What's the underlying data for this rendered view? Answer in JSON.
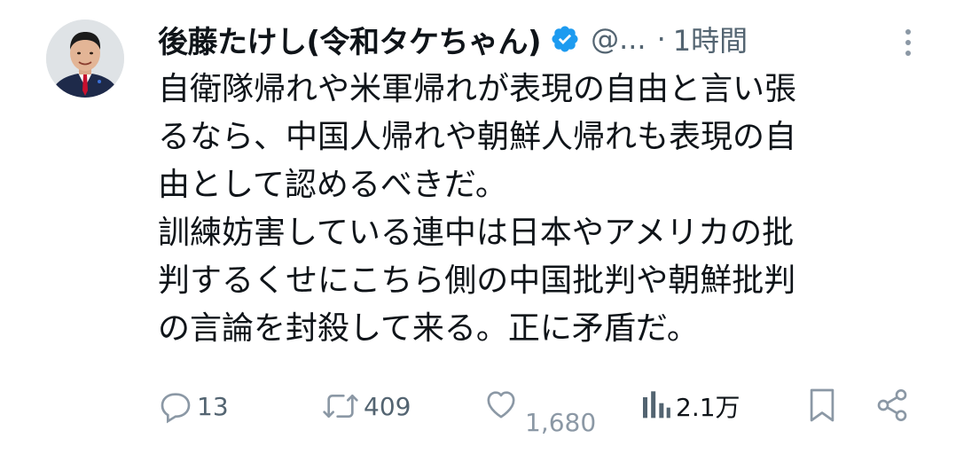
{
  "author": {
    "display_name": "後藤たけし(令和タケちゃん)",
    "handle": "@...",
    "separator": "·",
    "time": "1時間",
    "verified": true,
    "verified_color": "#1d9bf0"
  },
  "tweet": {
    "lines": [
      "自衛隊帰れや米軍帰れが表現の自由と言い張",
      "るなら、中国人帰れや朝鮮人帰れも表現の自",
      "由として認めるべきだ。",
      "訓練妨害している連中は日本やアメリカの批",
      "判するくせにこちら側の中国批判や朝鮮批判",
      "の言論を封殺して来る。正に矛盾だ。"
    ]
  },
  "actions": {
    "replies": "13",
    "retweets": "409",
    "likes": "1,680",
    "views": "2.1万"
  },
  "icons": {
    "reply": "reply-icon",
    "retweet": "retweet-icon",
    "like": "heart-icon",
    "views": "views-icon",
    "bookmark": "bookmark-icon",
    "share": "share-icon",
    "more": "more-icon",
    "verified": "verified-badge-icon"
  },
  "colors": {
    "text": "#0f1419",
    "secondary": "#536471",
    "accent": "#1d9bf0"
  }
}
